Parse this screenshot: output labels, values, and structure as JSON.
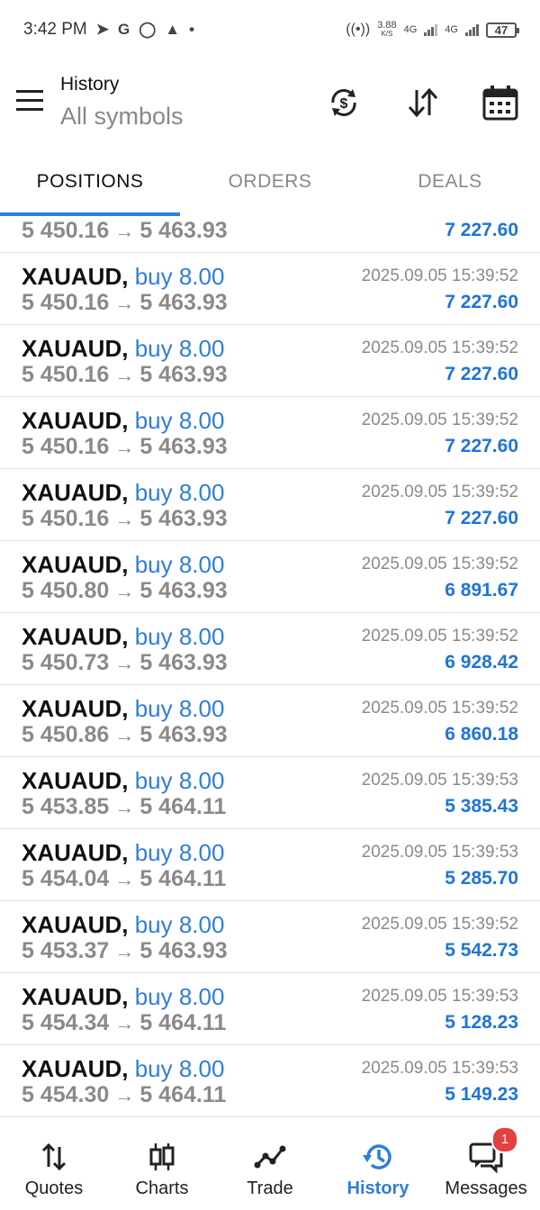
{
  "status_bar": {
    "time": "3:42 PM",
    "net_speed_value": "3.88",
    "net_speed_unit": "K/S",
    "net_type_1": "4G",
    "net_type_2": "4G",
    "battery": "47"
  },
  "header": {
    "title": "History",
    "subtitle": "All symbols"
  },
  "tabs": [
    {
      "label": "POSITIONS",
      "active": true
    },
    {
      "label": "ORDERS",
      "active": false
    },
    {
      "label": "DEALS",
      "active": false
    }
  ],
  "partial_row": {
    "open_price": "5 450.16",
    "close_price": "5 463.93",
    "profit": "7 227.60"
  },
  "rows": [
    {
      "symbol": "XAUAUD,",
      "side": "buy 8.00",
      "open_price": "5 450.16",
      "close_price": "5 463.93",
      "time": "2025.09.05 15:39:52",
      "profit": "7 227.60"
    },
    {
      "symbol": "XAUAUD,",
      "side": "buy 8.00",
      "open_price": "5 450.16",
      "close_price": "5 463.93",
      "time": "2025.09.05 15:39:52",
      "profit": "7 227.60"
    },
    {
      "symbol": "XAUAUD,",
      "side": "buy 8.00",
      "open_price": "5 450.16",
      "close_price": "5 463.93",
      "time": "2025.09.05 15:39:52",
      "profit": "7 227.60"
    },
    {
      "symbol": "XAUAUD,",
      "side": "buy 8.00",
      "open_price": "5 450.16",
      "close_price": "5 463.93",
      "time": "2025.09.05 15:39:52",
      "profit": "7 227.60"
    },
    {
      "symbol": "XAUAUD,",
      "side": "buy 8.00",
      "open_price": "5 450.80",
      "close_price": "5 463.93",
      "time": "2025.09.05 15:39:52",
      "profit": "6 891.67"
    },
    {
      "symbol": "XAUAUD,",
      "side": "buy 8.00",
      "open_price": "5 450.73",
      "close_price": "5 463.93",
      "time": "2025.09.05 15:39:52",
      "profit": "6 928.42"
    },
    {
      "symbol": "XAUAUD,",
      "side": "buy 8.00",
      "open_price": "5 450.86",
      "close_price": "5 463.93",
      "time": "2025.09.05 15:39:52",
      "profit": "6 860.18"
    },
    {
      "symbol": "XAUAUD,",
      "side": "buy 8.00",
      "open_price": "5 453.85",
      "close_price": "5 464.11",
      "time": "2025.09.05 15:39:53",
      "profit": "5 385.43"
    },
    {
      "symbol": "XAUAUD,",
      "side": "buy 8.00",
      "open_price": "5 454.04",
      "close_price": "5 464.11",
      "time": "2025.09.05 15:39:53",
      "profit": "5 285.70"
    },
    {
      "symbol": "XAUAUD,",
      "side": "buy 8.00",
      "open_price": "5 453.37",
      "close_price": "5 463.93",
      "time": "2025.09.05 15:39:52",
      "profit": "5 542.73"
    },
    {
      "symbol": "XAUAUD,",
      "side": "buy 8.00",
      "open_price": "5 454.34",
      "close_price": "5 464.11",
      "time": "2025.09.05 15:39:53",
      "profit": "5 128.23"
    },
    {
      "symbol": "XAUAUD,",
      "side": "buy 8.00",
      "open_price": "5 454.30",
      "close_price": "5 464.11",
      "time": "2025.09.05 15:39:53",
      "profit": "5 149.23"
    }
  ],
  "price_separator": "→",
  "bottom_nav": [
    {
      "label": "Quotes",
      "icon": "quotes-icon",
      "active": false
    },
    {
      "label": "Charts",
      "icon": "charts-icon",
      "active": false
    },
    {
      "label": "Trade",
      "icon": "trade-icon",
      "active": false
    },
    {
      "label": "History",
      "icon": "history-icon",
      "active": true
    },
    {
      "label": "Messages",
      "icon": "messages-icon",
      "active": false,
      "badge": "1"
    }
  ],
  "colors": {
    "accent": "#2f7ddc",
    "profit": "#1f74d6",
    "badge": "#e34040"
  }
}
